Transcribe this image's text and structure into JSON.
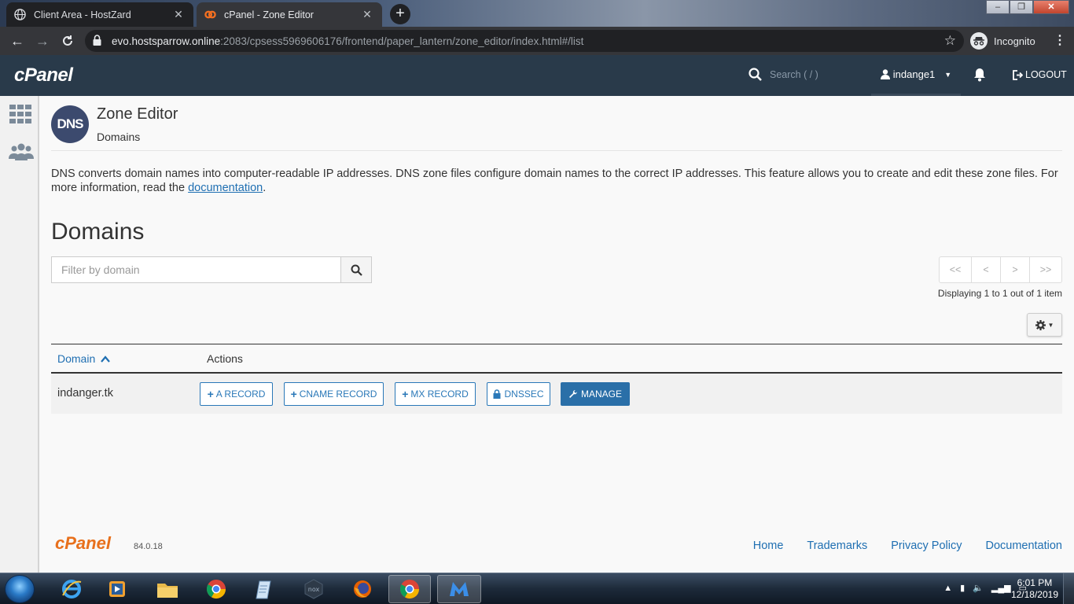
{
  "browser": {
    "tabs": [
      {
        "title": "Client Area - HostZard",
        "active": false
      },
      {
        "title": "cPanel - Zone Editor",
        "active": true
      }
    ],
    "url_host": "evo.hostsparrow.online",
    "url_rest": ":2083/cpsess5969606176/frontend/paper_lantern/zone_editor/index.html#/list",
    "incognito_label": "Incognito"
  },
  "header": {
    "logo": "cPanel",
    "search_placeholder": "Search ( / )",
    "username": "indange1",
    "logout_label": "LOGOUT"
  },
  "page": {
    "icon_text": "DNS",
    "title": "Zone Editor",
    "subtitle": "Domains",
    "description": "DNS converts domain names into computer-readable IP addresses. DNS zone files configure domain names to the correct IP addresses. This feature allows you to create and edit these zone files. For more information, read the",
    "doc_link": "documentation",
    "desc_end": ".",
    "section_title": "Domains",
    "filter_placeholder": "Filter by domain"
  },
  "pager": {
    "first": "<<",
    "prev": "<",
    "next": ">",
    "last": ">>",
    "info": "Displaying 1 to 1 out of 1 item"
  },
  "table": {
    "columns": {
      "domain": "Domain",
      "actions": "Actions"
    },
    "rows": [
      {
        "domain": "indanger.tk",
        "actions": [
          "A RECORD",
          "CNAME RECORD",
          "MX RECORD",
          "DNSSEC",
          "MANAGE"
        ]
      }
    ]
  },
  "footer": {
    "logo": "cPanel",
    "version": "84.0.18",
    "links": [
      "Home",
      "Trademarks",
      "Privacy Policy",
      "Documentation"
    ]
  },
  "taskbar": {
    "time": "6:01 PM",
    "date": "12/18/2019"
  },
  "colors": {
    "header_bg": "#293a4a",
    "link": "#1f6fb2",
    "primary_button": "#2a6fa8",
    "footer_logo": "#e8701c"
  }
}
